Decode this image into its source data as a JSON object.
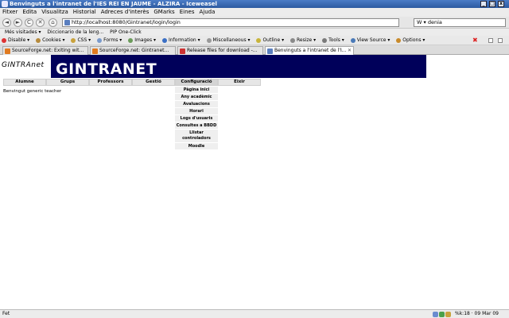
{
  "window": {
    "title": "Benvinguts a l'intranet de l'IES REI EN JAUME - ALZIRA - Iceweasel",
    "controls": [
      "_",
      "□",
      "x"
    ]
  },
  "menubar": [
    "Fitxer",
    "Edita",
    "Visualitza",
    "Historial",
    "Adreces d'interès",
    "GMarks",
    "Eines",
    "Ajuda"
  ],
  "navbar": {
    "back": "◄",
    "forward": "►",
    "reload": "C",
    "stop": "✕",
    "home": "⌂",
    "url": "http://localhost:8080/Gintranet/login/login",
    "search_value": "W ▾ denia"
  },
  "bookmarks": [
    "Més visitades ▾",
    "Diccionario de la leng...",
    "PIP One-Click"
  ],
  "devbar": [
    {
      "label": "Disable ▾",
      "icon": "disable-icon"
    },
    {
      "label": "Cookies ▾",
      "icon": "cookie-icon"
    },
    {
      "label": "CSS ▾",
      "icon": "css-icon"
    },
    {
      "label": "Forms ▾",
      "icon": "form-icon"
    },
    {
      "label": "Images ▾",
      "icon": "image-icon"
    },
    {
      "label": "Information ▾",
      "icon": "info-icon"
    },
    {
      "label": "Miscellaneous ▾",
      "icon": "misc-icon"
    },
    {
      "label": "Outline ▾",
      "icon": "outline-icon"
    },
    {
      "label": "Resize ▾",
      "icon": "resize-icon"
    },
    {
      "label": "Tools ▾",
      "icon": "tools-icon"
    },
    {
      "label": "View Source ▾",
      "icon": "source-icon"
    },
    {
      "label": "Options ▾",
      "icon": "options-icon"
    }
  ],
  "tabs": [
    {
      "label": "SourceForge.net: Exiting wit...",
      "active": false
    },
    {
      "label": "SourceForge.net: Gintranet...",
      "active": false
    },
    {
      "label": "Release files for download -...",
      "active": false
    },
    {
      "label": "Benvinguts a l'intranet de l'I...",
      "active": true
    }
  ],
  "site": {
    "logo": "GINTRAnet",
    "banner_title": "GINTRANET",
    "banner_color": "#00005a",
    "greeting": "Benvingut generic teacher"
  },
  "mainmenu": [
    "Alumne",
    "Grups",
    "Professors",
    "Gestió",
    "Configuració",
    "Eixir"
  ],
  "dropdown": [
    "Pàgina inici",
    "Any acadèmic",
    "Avaluacions",
    "Horari",
    "Logs d'usuaris",
    "Consultes a BBDD",
    "Llistar controladors",
    "Moodle"
  ],
  "statusbar": {
    "left": "Fet",
    "right": "%k:18 · 09 Mar 09"
  }
}
